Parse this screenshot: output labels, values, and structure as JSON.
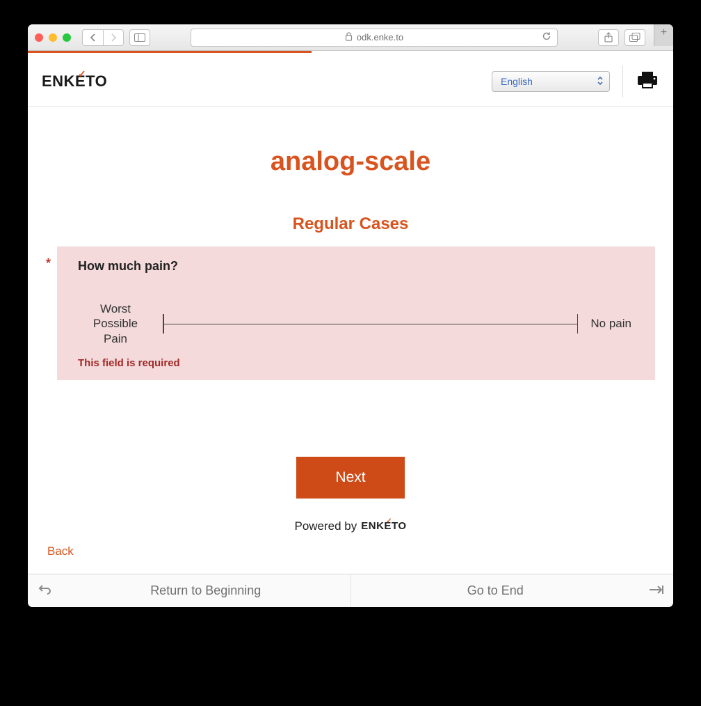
{
  "browser": {
    "url": "odk.enke.to"
  },
  "header": {
    "logo_text": "ENKETO",
    "language": "English"
  },
  "form": {
    "title": "analog-scale",
    "section": "Regular Cases",
    "question": {
      "label": "How much pain?",
      "required_mark": "*",
      "left_label": "Worst Possible Pain",
      "right_label": "No pain",
      "error": "This field is required"
    },
    "next_label": "Next",
    "powered_by": "Powered by",
    "back_label": "Back"
  },
  "footer": {
    "return_label": "Return to Beginning",
    "end_label": "Go to End"
  }
}
